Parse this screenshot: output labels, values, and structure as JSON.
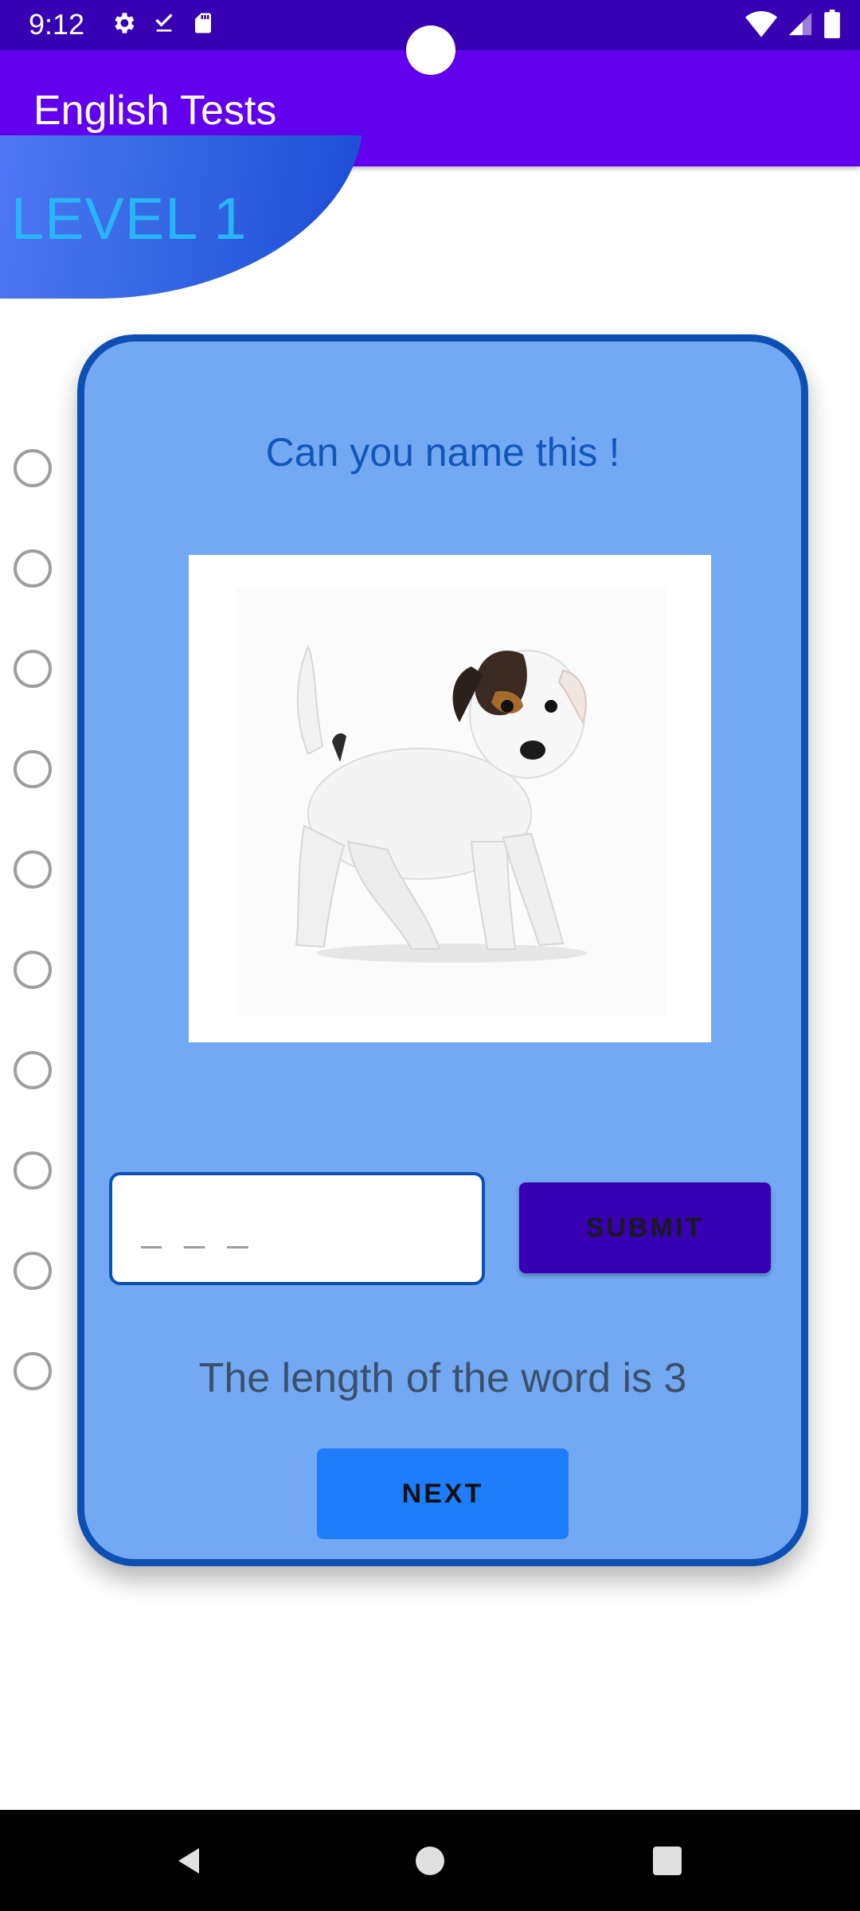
{
  "status_bar": {
    "time": "9:12",
    "left_icons": [
      "settings-icon",
      "download-done-icon",
      "sd-card-icon"
    ],
    "right_icons": [
      "wifi-icon",
      "signal-icon",
      "battery-icon"
    ]
  },
  "app_bar": {
    "title": "English Tests"
  },
  "level": {
    "label": "LEVEL 1"
  },
  "quiz": {
    "question": "Can you name this !",
    "picture_subject": "puppy",
    "answer_placeholder": "_ _ _",
    "submit_label": "SUBMIT",
    "hint": "The length of the word is 3",
    "next_label": "NEXT"
  },
  "binder_rings_count": 10,
  "nav_bar": {
    "buttons": [
      "back-icon",
      "home-icon",
      "recents-icon"
    ]
  },
  "colors": {
    "status_bar": "#3700b3",
    "app_bar": "#6200ee",
    "card_bg": "#73a9f3",
    "card_border": "#0d4fb3",
    "submit_bg": "#3700b3",
    "next_bg": "#1e7dfb",
    "level_text": "#29b6f6"
  }
}
